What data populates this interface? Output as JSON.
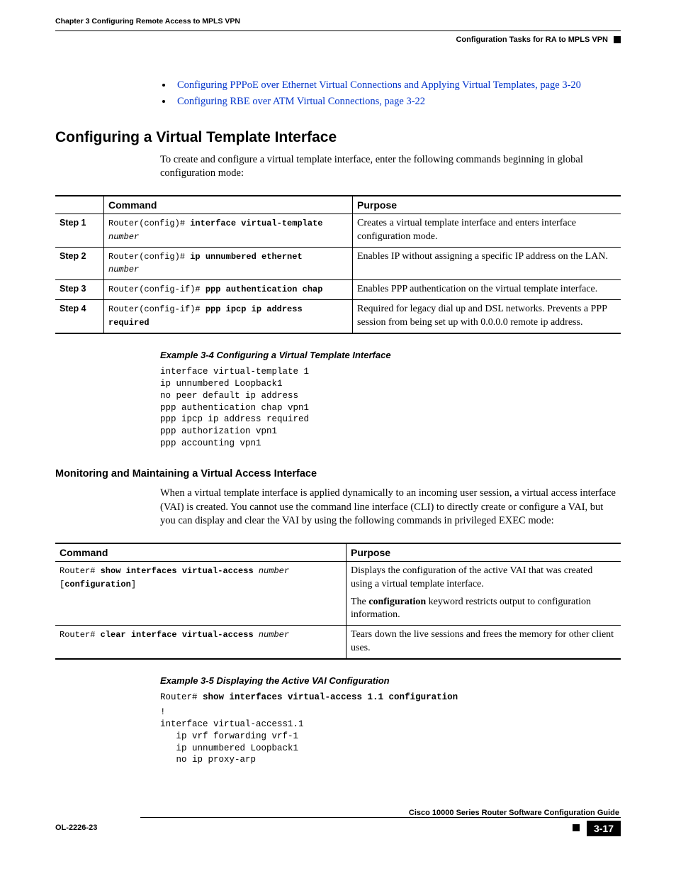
{
  "header": {
    "chapter": "Chapter 3      Configuring Remote Access to MPLS VPN",
    "right_title": "Configuration Tasks for RA to MPLS VPN"
  },
  "links": {
    "item1": "Configuring PPPoE over Ethernet Virtual Connections and Applying Virtual Templates, page 3-20",
    "item2": "Configuring RBE over ATM Virtual Connections, page 3-22"
  },
  "h2": "Configuring a Virtual Template Interface",
  "p1": "To create and configure a virtual template interface, enter the following commands beginning in global configuration mode:",
  "table1": {
    "h_step": "",
    "h_cmd": "Command",
    "h_purpose": "Purpose",
    "r1_step": "Step 1",
    "r1_prompt": "Router(config)# ",
    "r1_bold": "interface virtual-template",
    "r1_ital": "number",
    "r1_purpose": "Creates a virtual template interface and enters interface configuration mode.",
    "r2_step": "Step 2",
    "r2_prompt": "Router(config)# ",
    "r2_bold": "ip unnumbered ethernet",
    "r2_ital": "number",
    "r2_purpose": "Enables IP without assigning a specific IP address on the LAN.",
    "r3_step": "Step 3",
    "r3_prompt": "Router(config-if)# ",
    "r3_bold": "ppp authentication chap",
    "r3_purpose": "Enables PPP authentication on the virtual template interface.",
    "r4_step": "Step 4",
    "r4_prompt": "Router(config-if)# ",
    "r4_bold": "ppp ipcp ip address required",
    "r4_purpose": "Required for legacy dial up and DSL networks. Prevents a PPP session from being set up with 0.0.0.0 remote ip address."
  },
  "example34_title": "Example 3-4     Configuring a Virtual Template Interface",
  "example34_code": "interface virtual-template 1\nip unnumbered Loopback1\nno peer default ip address\nppp authentication chap vpn1\nppp ipcp ip address required\nppp authorization vpn1\nppp accounting vpn1",
  "h3": "Monitoring and Maintaining a Virtual Access Interface",
  "p2": "When a virtual template interface is applied dynamically to an incoming user session, a virtual access interface (VAI) is created. You cannot use the command line interface (CLI) to directly create or configure a VAI, but you can display and clear the VAI by using the following commands in privileged EXEC mode:",
  "table2": {
    "h_cmd": "Command",
    "h_purpose": "Purpose",
    "r1_prompt": "Router# ",
    "r1_bold1": "show interfaces virtual-access",
    "r1_ital": " number",
    "r1_bracket_open": " [",
    "r1_bold2": "configuration",
    "r1_bracket_close": "]",
    "r1_purpose_p1": "Displays the configuration of the active VAI that was created using a virtual template interface.",
    "r1_purpose_p2a": "The ",
    "r1_purpose_p2b": "configuration",
    "r1_purpose_p2c": " keyword restricts output to configuration information.",
    "r2_prompt": "Router# ",
    "r2_bold": "clear interface virtual-access",
    "r2_ital": " number",
    "r2_purpose": "Tears down the live sessions and frees the memory for other client uses."
  },
  "example35_title": "Example 3-5     Displaying the Active VAI Configuration",
  "example35_prompt": "Router# ",
  "example35_cmd_bold": "show interfaces virtual-access 1.1 configuration",
  "example35_code": "!\ninterface virtual-access1.1\n   ip vrf forwarding vrf-1\n   ip unnumbered Loopback1\n   no ip proxy-arp",
  "footer": {
    "guide": "Cisco 10000 Series Router Software Configuration Guide",
    "doc_id": "OL-2226-23",
    "page_num": "3-17"
  }
}
